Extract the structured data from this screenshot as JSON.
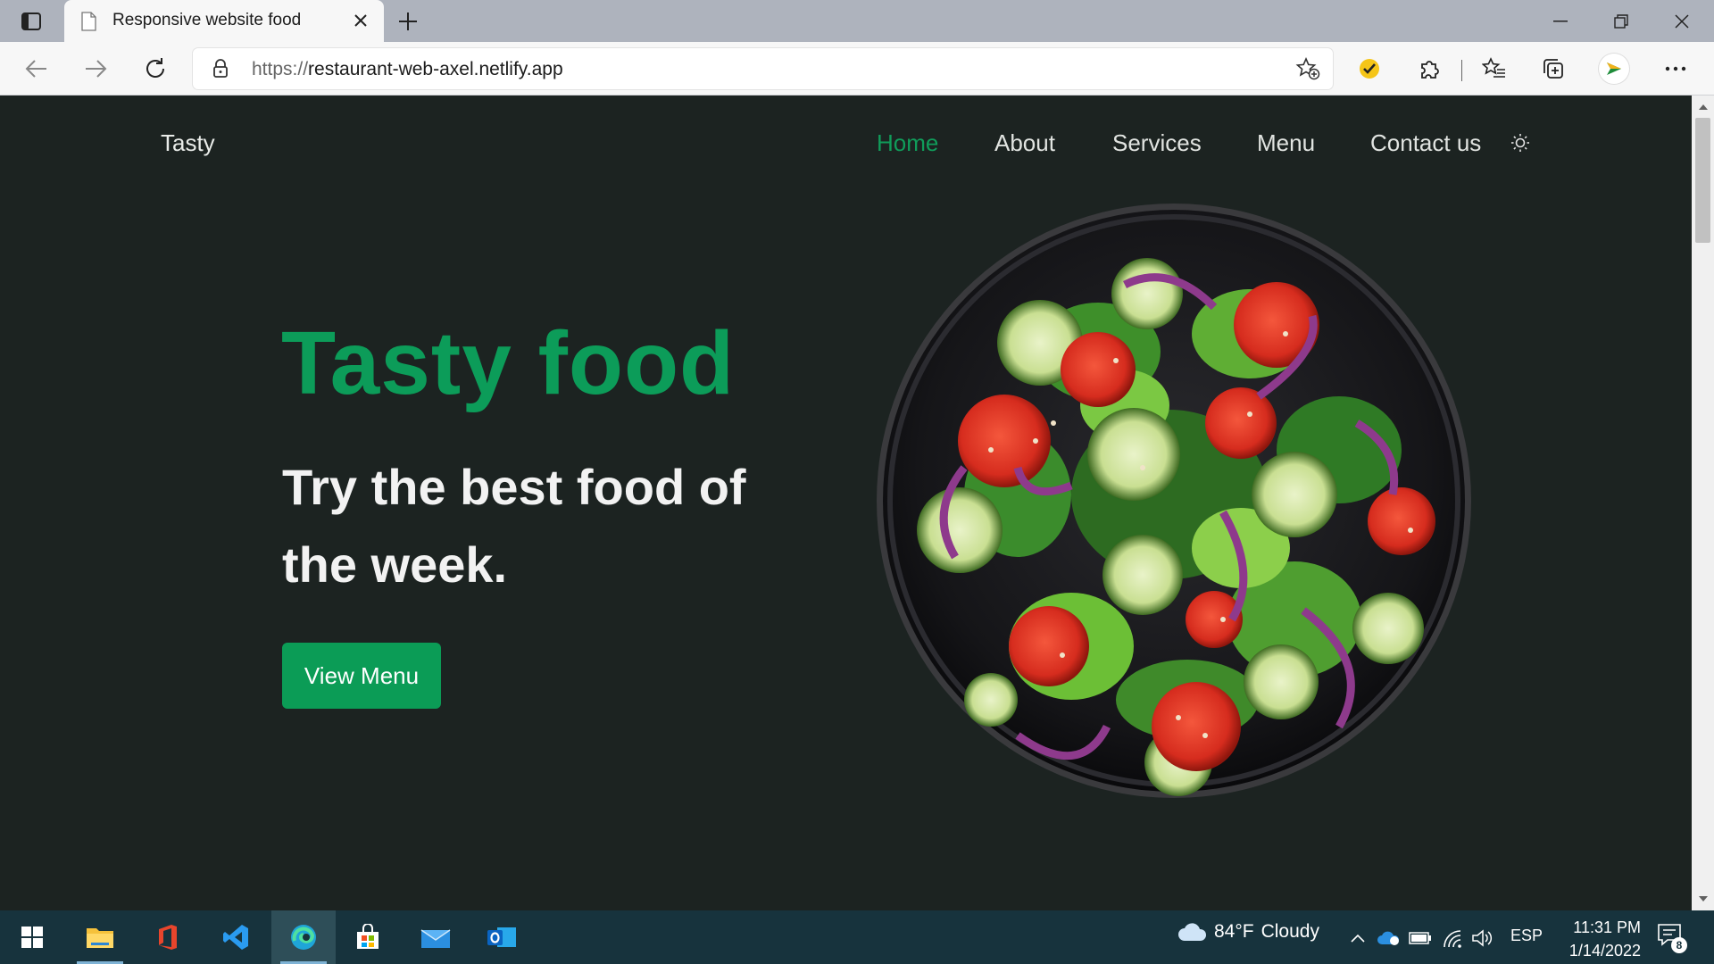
{
  "browser": {
    "tab_title": "Responsive website food",
    "url_scheme": "https://",
    "url_host": "restaurant-web-axel.netlify.app"
  },
  "site": {
    "brand": "Tasty",
    "nav": [
      {
        "label": "Home",
        "active": true
      },
      {
        "label": "About",
        "active": false
      },
      {
        "label": "Services",
        "active": false
      },
      {
        "label": "Menu",
        "active": false
      },
      {
        "label": "Contact us",
        "active": false
      }
    ],
    "hero": {
      "title": "Tasty food",
      "subtitle": "Try the best food of the week.",
      "cta_label": "View Menu"
    },
    "image": "salad-bowl"
  },
  "taskbar": {
    "apps": [
      "start-icon",
      "file-explorer-icon",
      "office-icon",
      "vscode-icon",
      "edge-icon",
      "store-icon",
      "mail-icon",
      "outlook-icon"
    ],
    "weather": {
      "temp": "84°F",
      "condition": "Cloudy"
    },
    "language": "ESP",
    "time": "11:31 PM",
    "date": "1/14/2022",
    "notifications": "8"
  },
  "colors": {
    "page_bg": "#1c2321",
    "accent": "#0c9c59",
    "taskbar_bg": "#17333d"
  }
}
